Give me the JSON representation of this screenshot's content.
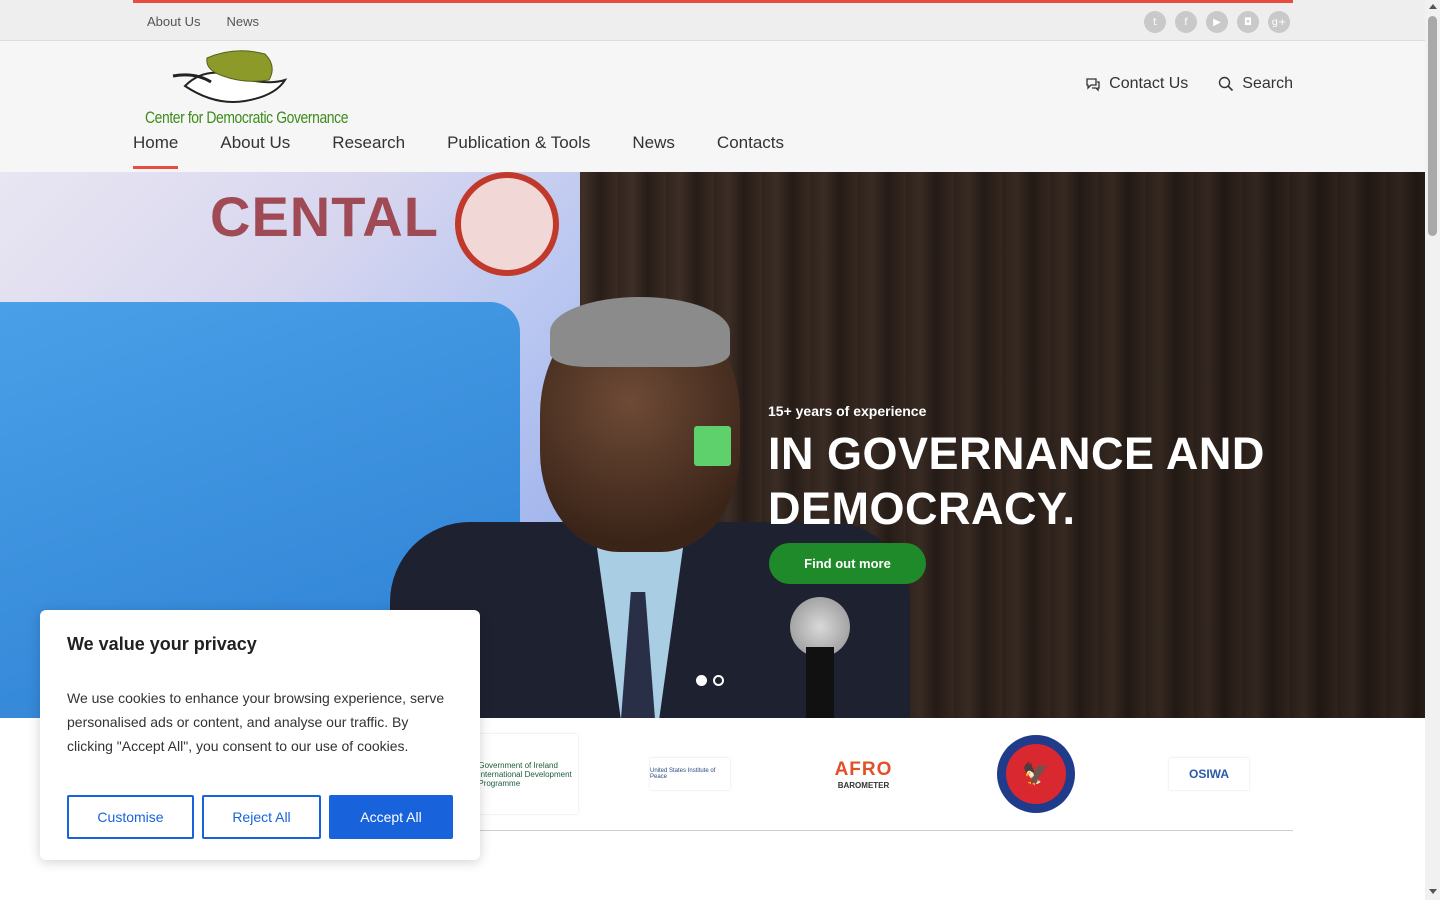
{
  "topbar": {
    "links": [
      "About Us",
      "News"
    ],
    "social_icons": [
      "twitter-icon",
      "facebook-icon",
      "youtube-icon",
      "instagram-icon",
      "google-plus-icon"
    ],
    "accent_color": "#e74c3c"
  },
  "header": {
    "logo_text": "Center for Democratic Governance",
    "contact_label": "Contact Us",
    "search_label": "Search",
    "nav": [
      "Home",
      "About Us",
      "Research",
      "Publication & Tools",
      "News",
      "Contacts"
    ],
    "active_nav": "Home"
  },
  "hero": {
    "banner_text": "CENTAL",
    "kicker": "15+ years of experience",
    "headline": "IN GOVERNANCE AND DEMOCRACY.",
    "cta_label": "Find out more",
    "cta_color": "#1f8a2a",
    "slides": 2,
    "active_slide": 1
  },
  "partners": {
    "ireland_text": "Government of Ireland International Development Programme",
    "usip_text": "United States Institute of Peace",
    "afro_brand": "AFRO",
    "afro_sub": "BAROMETER",
    "osiwa_text": "OSIWA"
  },
  "cookie": {
    "title": "We value your privacy",
    "body": "We use cookies to enhance your browsing experience, serve personalised ads or content, and analyse our traffic. By clicking \"Accept All\", you consent to our use of cookies.",
    "customise": "Customise",
    "reject": "Reject All",
    "accept": "Accept All",
    "accent_color": "#1863dc"
  }
}
